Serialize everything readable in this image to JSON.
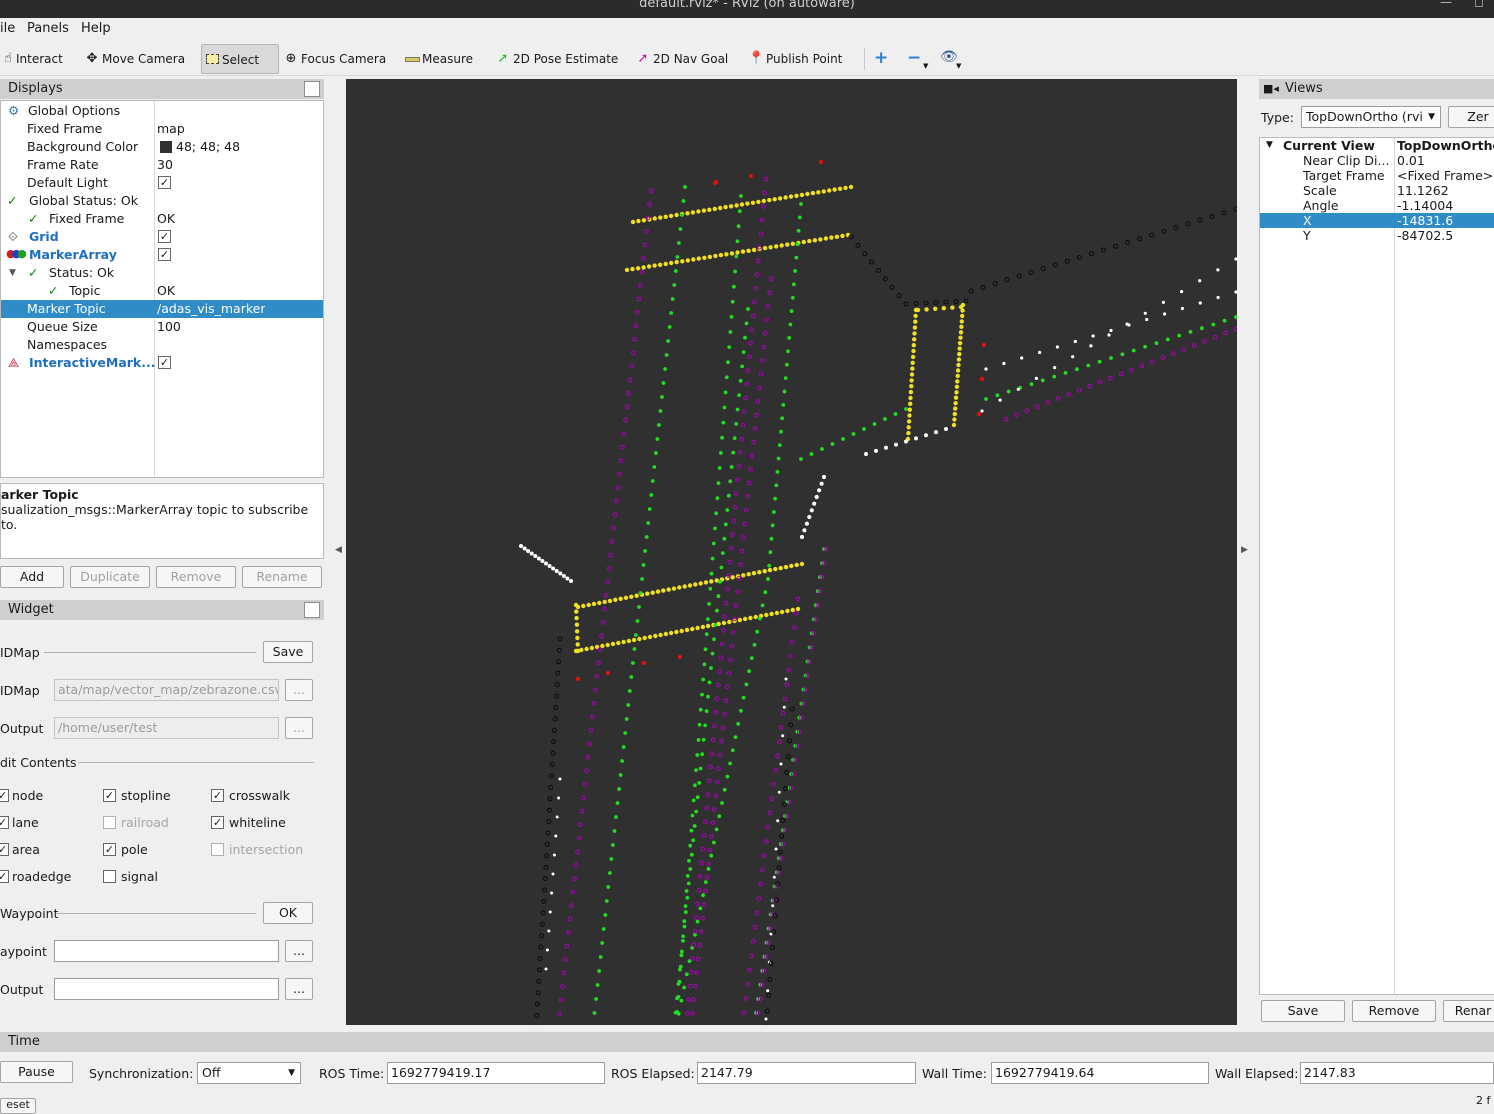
{
  "window": {
    "title": "default.rviz* - RViz (on autoware)"
  },
  "menu": {
    "file": "ile",
    "panels": "Panels",
    "help": "Help"
  },
  "toolbar": {
    "interact": "Interact",
    "move_camera": "Move Camera",
    "select": "Select",
    "focus_camera": "Focus Camera",
    "measure": "Measure",
    "pose_estimate": "2D Pose Estimate",
    "nav_goal": "2D Nav Goal",
    "publish_point": "Publish Point"
  },
  "displays": {
    "header": "Displays",
    "rows": {
      "global_options": "Global Options",
      "fixed_frame": "Fixed Frame",
      "fixed_frame_value": "map",
      "background_color": "Background Color",
      "background_color_value": "48; 48; 48",
      "frame_rate": "Frame Rate",
      "frame_rate_value": "30",
      "default_light": "Default Light",
      "global_status": "Global Status: Ok",
      "status_fixed_frame": "Fixed Frame",
      "status_fixed_frame_value": "OK",
      "grid": "Grid",
      "marker_array": "MarkerArray",
      "status_ok": "Status: Ok",
      "topic": "Topic",
      "topic_value": "OK",
      "marker_topic": "Marker Topic",
      "marker_topic_value": "/adas_vis_marker",
      "queue_size": "Queue Size",
      "queue_size_value": "100",
      "namespaces": "Namespaces",
      "interactive_markers": "InteractiveMark..."
    },
    "desc_title": "arker Topic",
    "desc_text": "sualization_msgs::MarkerArray topic to subscribe to.",
    "buttons": {
      "add": "Add",
      "duplicate": "Duplicate",
      "remove": "Remove",
      "rename": "Rename"
    }
  },
  "widget": {
    "header": "Widget",
    "idmap_save_label": "IDMap",
    "save": "Save",
    "idmap_path_label": "IDMap",
    "idmap_path_value": "ata/map/vector_map/zebrazone.csv,",
    "output_label": "Output",
    "output_value": "/home/user/test",
    "browse": "...",
    "edit_contents": "dit Contents",
    "checks": {
      "node": "node",
      "stopline": "stopline",
      "crosswalk": "crosswalk",
      "lane": "lane",
      "railroad": "railroad",
      "whiteline": "whiteline",
      "area": "area",
      "pole": "pole",
      "intersection": "intersection",
      "roadedge": "roadedge",
      "signal": "signal"
    },
    "waypoint_label": "Waypoint",
    "ok": "OK",
    "waypoint2_label": "aypoint",
    "output2_label": "Output"
  },
  "views": {
    "header": "Views",
    "type_label": "Type:",
    "type_value": "TopDownOrtho (rvi",
    "zero": "Zer",
    "current_view": "Current View",
    "current_view_value": "TopDownOrtho",
    "near_clip": "Near Clip Di...",
    "near_clip_value": "0.01",
    "target_frame": "Target Frame",
    "target_frame_value": "<Fixed Frame>",
    "scale": "Scale",
    "scale_value": "11.1262",
    "angle": "Angle",
    "angle_value": "-1.14004",
    "x": "X",
    "x_value": "-14831.6",
    "y": "Y",
    "y_value": "-84702.5",
    "buttons": {
      "save": "Save",
      "remove": "Remove",
      "rename": "Renar"
    }
  },
  "time": {
    "header": "Time",
    "pause": "Pause",
    "sync_label": "Synchronization:",
    "sync_value": "Off",
    "ros_time_label": "ROS Time:",
    "ros_time_value": "1692779419.17",
    "ros_elapsed_label": "ROS Elapsed:",
    "ros_elapsed_value": "2147.79",
    "wall_time_label": "Wall Time:",
    "wall_time_value": "1692779419.64",
    "wall_elapsed_label": "Wall Elapsed:",
    "wall_elapsed_value": "2147.83",
    "reset": "eset",
    "fps": "2 f"
  },
  "colors": {
    "viewport_bg": "#303030",
    "yellow": "#f0e020",
    "green": "#22dd22",
    "purple": "#b000c0",
    "white": "#ffffff",
    "red": "#e01010",
    "selection": "#308cc6"
  }
}
